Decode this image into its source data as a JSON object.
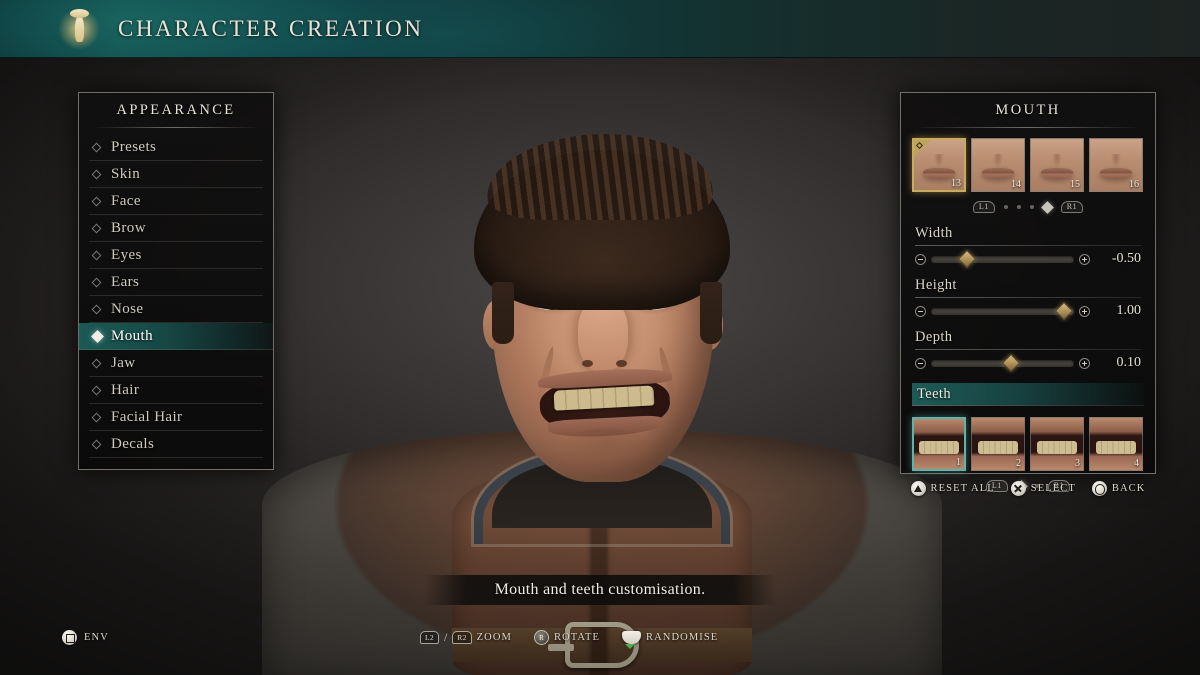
{
  "header": {
    "title": "CHARACTER CREATION",
    "emblem_icon": "figure-emblem-icon"
  },
  "sidebar": {
    "title": "APPEARANCE",
    "items": [
      {
        "label": "Presets",
        "selected": false
      },
      {
        "label": "Skin",
        "selected": false
      },
      {
        "label": "Face",
        "selected": false
      },
      {
        "label": "Brow",
        "selected": false
      },
      {
        "label": "Eyes",
        "selected": false
      },
      {
        "label": "Ears",
        "selected": false
      },
      {
        "label": "Nose",
        "selected": false
      },
      {
        "label": "Mouth",
        "selected": true
      },
      {
        "label": "Jaw",
        "selected": false
      },
      {
        "label": "Hair",
        "selected": false
      },
      {
        "label": "Facial Hair",
        "selected": false
      },
      {
        "label": "Decals",
        "selected": false
      }
    ]
  },
  "right_panel": {
    "title": "MOUTH",
    "mouth_thumbs": [
      {
        "num": "13",
        "selected": true
      },
      {
        "num": "14",
        "selected": false
      },
      {
        "num": "15",
        "selected": false
      },
      {
        "num": "16",
        "selected": false
      }
    ],
    "mouth_pager": {
      "prev_bumper": "L1",
      "next_bumper": "R1",
      "dots": 4,
      "active_index": 3
    },
    "sliders": [
      {
        "label": "Width",
        "value": "-0.50",
        "percent": 25
      },
      {
        "label": "Height",
        "value": "1.00",
        "percent": 93
      },
      {
        "label": "Depth",
        "value": "0.10",
        "percent": 56
      }
    ],
    "teeth": {
      "label": "Teeth",
      "thumbs": [
        {
          "num": "1",
          "selected": true
        },
        {
          "num": "2",
          "selected": false
        },
        {
          "num": "3",
          "selected": false
        },
        {
          "num": "4",
          "selected": false
        }
      ],
      "pager": {
        "prev_bumper": "L1",
        "next_bumper": "R1",
        "dots": 2,
        "active_index": 0
      }
    },
    "prompts": [
      {
        "button": "triangle",
        "label": "RESET ALL"
      },
      {
        "button": "cross",
        "label": "SELECT"
      },
      {
        "button": "circle",
        "label": "BACK"
      }
    ]
  },
  "tooltip": {
    "text": "Mouth and teeth customisation."
  },
  "bottom": {
    "env": {
      "button": "square",
      "label": "ENV"
    },
    "zoom": {
      "left_trigger": "L2",
      "separator": "/",
      "right_trigger": "R2",
      "label": "ZOOM"
    },
    "rotate": {
      "stick": "R",
      "label": "ROTATE"
    },
    "randomise": {
      "input": "touchpad",
      "label": "RANDOMISE"
    }
  },
  "colors": {
    "accent_teal": "#1c605c",
    "accent_gold": "#c9ab5e",
    "text_primary": "#e9e4d8",
    "panel_bg": "#100f0f"
  }
}
